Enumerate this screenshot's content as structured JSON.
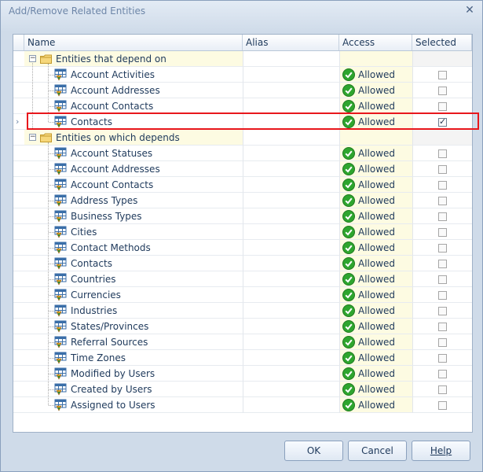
{
  "window": {
    "title": "Add/Remove Related Entities",
    "close_glyph": "✕"
  },
  "grid": {
    "columns": {
      "name": "Name",
      "alias": "Alias",
      "access": "Access",
      "selected": "Selected"
    },
    "groups": [
      {
        "label": "Entities that depend on",
        "expander": "−",
        "rows": [
          {
            "name": "Account Activities",
            "alias": "",
            "access": "Allowed",
            "selected": false
          },
          {
            "name": "Account Addresses",
            "alias": "",
            "access": "Allowed",
            "selected": false
          },
          {
            "name": "Account Contacts",
            "alias": "",
            "access": "Allowed",
            "selected": false
          },
          {
            "name": "Contacts",
            "alias": "",
            "access": "Allowed",
            "selected": true,
            "current": true
          }
        ]
      },
      {
        "label": "Entities on which depends",
        "expander": "−",
        "rows": [
          {
            "name": "Account Statuses",
            "alias": "",
            "access": "Allowed",
            "selected": false
          },
          {
            "name": "Account Addresses",
            "alias": "",
            "access": "Allowed",
            "selected": false
          },
          {
            "name": "Account Contacts",
            "alias": "",
            "access": "Allowed",
            "selected": false
          },
          {
            "name": "Address Types",
            "alias": "",
            "access": "Allowed",
            "selected": false
          },
          {
            "name": "Business Types",
            "alias": "",
            "access": "Allowed",
            "selected": false
          },
          {
            "name": "Cities",
            "alias": "",
            "access": "Allowed",
            "selected": false
          },
          {
            "name": "Contact Methods",
            "alias": "",
            "access": "Allowed",
            "selected": false
          },
          {
            "name": "Contacts",
            "alias": "",
            "access": "Allowed",
            "selected": false
          },
          {
            "name": "Countries",
            "alias": "",
            "access": "Allowed",
            "selected": false
          },
          {
            "name": "Currencies",
            "alias": "",
            "access": "Allowed",
            "selected": false
          },
          {
            "name": "Industries",
            "alias": "",
            "access": "Allowed",
            "selected": false
          },
          {
            "name": "States/Provinces",
            "alias": "",
            "access": "Allowed",
            "selected": false
          },
          {
            "name": "Referral Sources",
            "alias": "",
            "access": "Allowed",
            "selected": false
          },
          {
            "name": "Time Zones",
            "alias": "",
            "access": "Allowed",
            "selected": false
          },
          {
            "name": "Modified by Users",
            "alias": "",
            "access": "Allowed",
            "selected": false
          },
          {
            "name": "Created by Users",
            "alias": "",
            "access": "Allowed",
            "selected": false
          },
          {
            "name": "Assigned to Users",
            "alias": "",
            "access": "Allowed",
            "selected": false
          }
        ]
      }
    ],
    "current_row_indicator": "›"
  },
  "buttons": {
    "ok": "OK",
    "cancel": "Cancel",
    "help": "Help"
  },
  "colors": {
    "accent": "#1e395b",
    "highlight_border": "#e8171c",
    "allowed_green": "#2ea52e"
  }
}
